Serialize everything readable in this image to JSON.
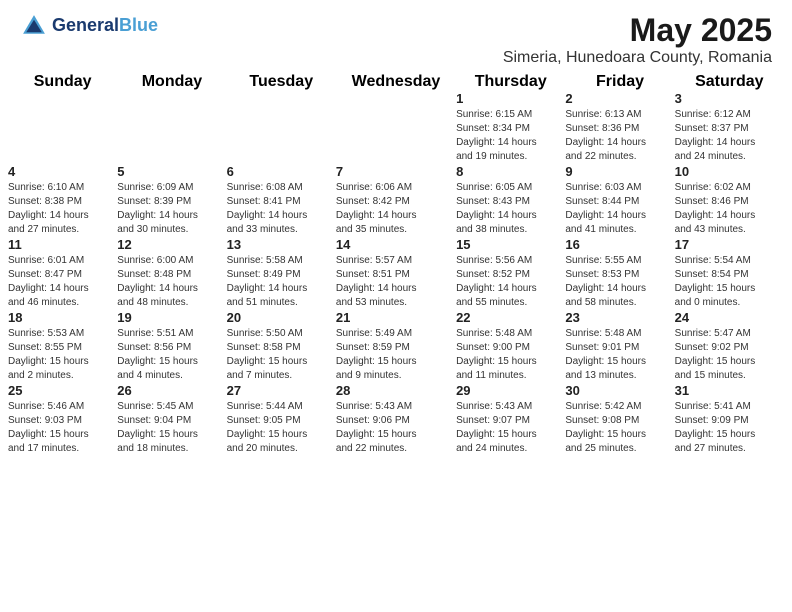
{
  "header": {
    "logo_line1": "General",
    "logo_line2": "Blue",
    "title": "May 2025",
    "subtitle": "Simeria, Hunedoara County, Romania"
  },
  "weekdays": [
    "Sunday",
    "Monday",
    "Tuesday",
    "Wednesday",
    "Thursday",
    "Friday",
    "Saturday"
  ],
  "weeks": [
    [
      {
        "day": "",
        "info": ""
      },
      {
        "day": "",
        "info": ""
      },
      {
        "day": "",
        "info": ""
      },
      {
        "day": "",
        "info": ""
      },
      {
        "day": "1",
        "info": "Sunrise: 6:15 AM\nSunset: 8:34 PM\nDaylight: 14 hours\nand 19 minutes."
      },
      {
        "day": "2",
        "info": "Sunrise: 6:13 AM\nSunset: 8:36 PM\nDaylight: 14 hours\nand 22 minutes."
      },
      {
        "day": "3",
        "info": "Sunrise: 6:12 AM\nSunset: 8:37 PM\nDaylight: 14 hours\nand 24 minutes."
      }
    ],
    [
      {
        "day": "4",
        "info": "Sunrise: 6:10 AM\nSunset: 8:38 PM\nDaylight: 14 hours\nand 27 minutes."
      },
      {
        "day": "5",
        "info": "Sunrise: 6:09 AM\nSunset: 8:39 PM\nDaylight: 14 hours\nand 30 minutes."
      },
      {
        "day": "6",
        "info": "Sunrise: 6:08 AM\nSunset: 8:41 PM\nDaylight: 14 hours\nand 33 minutes."
      },
      {
        "day": "7",
        "info": "Sunrise: 6:06 AM\nSunset: 8:42 PM\nDaylight: 14 hours\nand 35 minutes."
      },
      {
        "day": "8",
        "info": "Sunrise: 6:05 AM\nSunset: 8:43 PM\nDaylight: 14 hours\nand 38 minutes."
      },
      {
        "day": "9",
        "info": "Sunrise: 6:03 AM\nSunset: 8:44 PM\nDaylight: 14 hours\nand 41 minutes."
      },
      {
        "day": "10",
        "info": "Sunrise: 6:02 AM\nSunset: 8:46 PM\nDaylight: 14 hours\nand 43 minutes."
      }
    ],
    [
      {
        "day": "11",
        "info": "Sunrise: 6:01 AM\nSunset: 8:47 PM\nDaylight: 14 hours\nand 46 minutes."
      },
      {
        "day": "12",
        "info": "Sunrise: 6:00 AM\nSunset: 8:48 PM\nDaylight: 14 hours\nand 48 minutes."
      },
      {
        "day": "13",
        "info": "Sunrise: 5:58 AM\nSunset: 8:49 PM\nDaylight: 14 hours\nand 51 minutes."
      },
      {
        "day": "14",
        "info": "Sunrise: 5:57 AM\nSunset: 8:51 PM\nDaylight: 14 hours\nand 53 minutes."
      },
      {
        "day": "15",
        "info": "Sunrise: 5:56 AM\nSunset: 8:52 PM\nDaylight: 14 hours\nand 55 minutes."
      },
      {
        "day": "16",
        "info": "Sunrise: 5:55 AM\nSunset: 8:53 PM\nDaylight: 14 hours\nand 58 minutes."
      },
      {
        "day": "17",
        "info": "Sunrise: 5:54 AM\nSunset: 8:54 PM\nDaylight: 15 hours\nand 0 minutes."
      }
    ],
    [
      {
        "day": "18",
        "info": "Sunrise: 5:53 AM\nSunset: 8:55 PM\nDaylight: 15 hours\nand 2 minutes."
      },
      {
        "day": "19",
        "info": "Sunrise: 5:51 AM\nSunset: 8:56 PM\nDaylight: 15 hours\nand 4 minutes."
      },
      {
        "day": "20",
        "info": "Sunrise: 5:50 AM\nSunset: 8:58 PM\nDaylight: 15 hours\nand 7 minutes."
      },
      {
        "day": "21",
        "info": "Sunrise: 5:49 AM\nSunset: 8:59 PM\nDaylight: 15 hours\nand 9 minutes."
      },
      {
        "day": "22",
        "info": "Sunrise: 5:48 AM\nSunset: 9:00 PM\nDaylight: 15 hours\nand 11 minutes."
      },
      {
        "day": "23",
        "info": "Sunrise: 5:48 AM\nSunset: 9:01 PM\nDaylight: 15 hours\nand 13 minutes."
      },
      {
        "day": "24",
        "info": "Sunrise: 5:47 AM\nSunset: 9:02 PM\nDaylight: 15 hours\nand 15 minutes."
      }
    ],
    [
      {
        "day": "25",
        "info": "Sunrise: 5:46 AM\nSunset: 9:03 PM\nDaylight: 15 hours\nand 17 minutes."
      },
      {
        "day": "26",
        "info": "Sunrise: 5:45 AM\nSunset: 9:04 PM\nDaylight: 15 hours\nand 18 minutes."
      },
      {
        "day": "27",
        "info": "Sunrise: 5:44 AM\nSunset: 9:05 PM\nDaylight: 15 hours\nand 20 minutes."
      },
      {
        "day": "28",
        "info": "Sunrise: 5:43 AM\nSunset: 9:06 PM\nDaylight: 15 hours\nand 22 minutes."
      },
      {
        "day": "29",
        "info": "Sunrise: 5:43 AM\nSunset: 9:07 PM\nDaylight: 15 hours\nand 24 minutes."
      },
      {
        "day": "30",
        "info": "Sunrise: 5:42 AM\nSunset: 9:08 PM\nDaylight: 15 hours\nand 25 minutes."
      },
      {
        "day": "31",
        "info": "Sunrise: 5:41 AM\nSunset: 9:09 PM\nDaylight: 15 hours\nand 27 minutes."
      }
    ]
  ]
}
